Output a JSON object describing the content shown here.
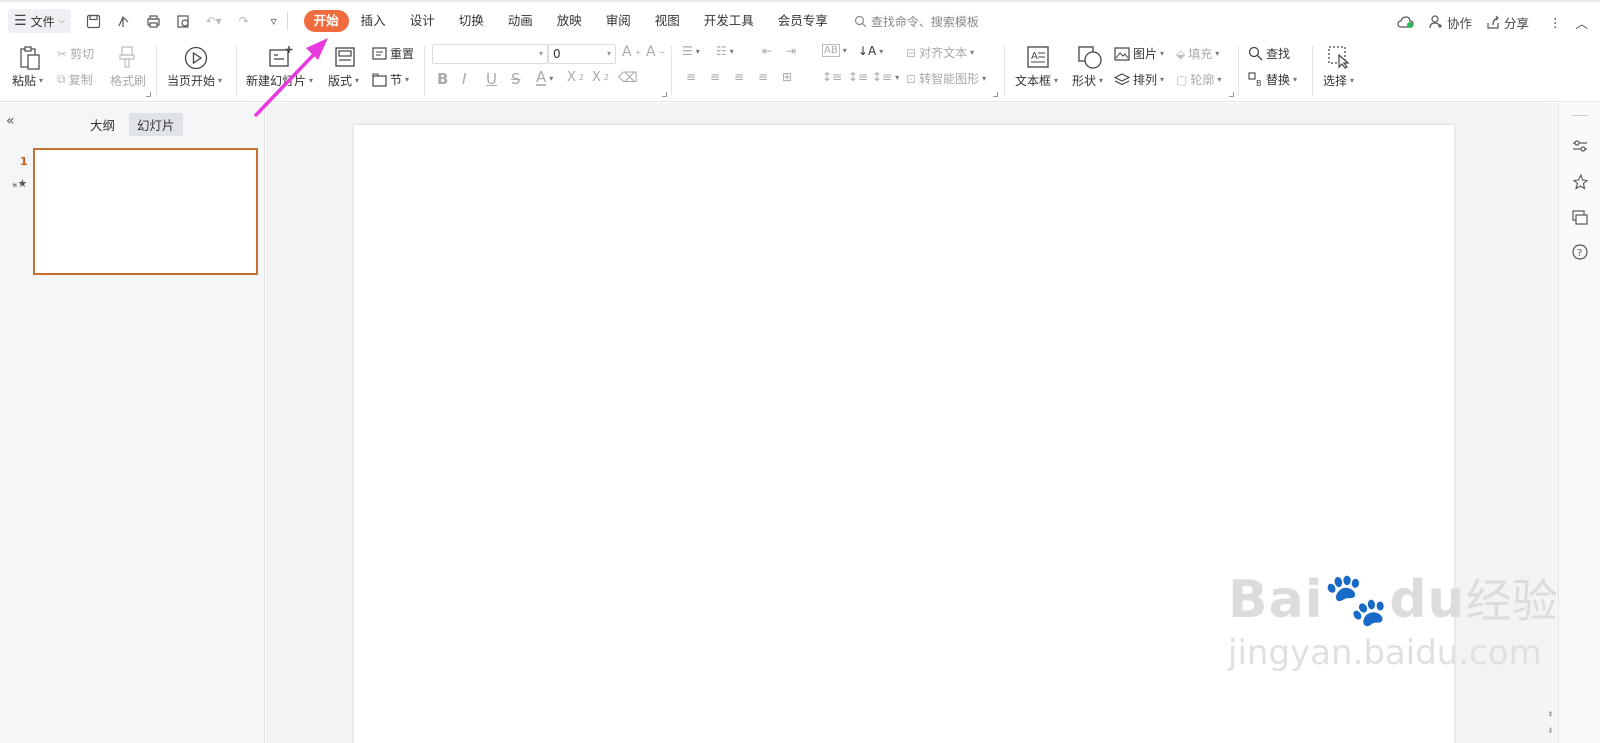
{
  "menubar": {
    "file_label": "文件",
    "tabs": [
      {
        "label": "开始",
        "active": true
      },
      {
        "label": "插入"
      },
      {
        "label": "设计"
      },
      {
        "label": "切换"
      },
      {
        "label": "动画"
      },
      {
        "label": "放映"
      },
      {
        "label": "审阅"
      },
      {
        "label": "视图"
      },
      {
        "label": "开发工具"
      },
      {
        "label": "会员专享"
      }
    ],
    "search_placeholder": "查找命令、搜索模板",
    "collaborate_label": "协作",
    "share_label": "分享",
    "accent_color": "#f06c3e"
  },
  "ribbon": {
    "paste": "粘贴",
    "cut": "剪切",
    "copy": "复制",
    "format_painter": "格式刷",
    "from_current": "当页开始",
    "new_slide": "新建幻灯片",
    "layout": "版式",
    "reset": "重置",
    "section": "节",
    "font_size": "0",
    "align_text": "对齐文本",
    "smartart": "转智能图形",
    "textbox": "文本框",
    "shape": "形状",
    "picture": "图片",
    "arrange": "排列",
    "fill": "填充",
    "outline": "轮廓",
    "find": "查找",
    "replace": "替换",
    "select": "选择"
  },
  "left_panel": {
    "tab_outline": "大纲",
    "tab_slides": "幻灯片",
    "slide_number": "1"
  },
  "watermark": {
    "brand": "Bai",
    "brand2": "du",
    "cn": "经验",
    "url": "jingyan.baidu.com"
  }
}
